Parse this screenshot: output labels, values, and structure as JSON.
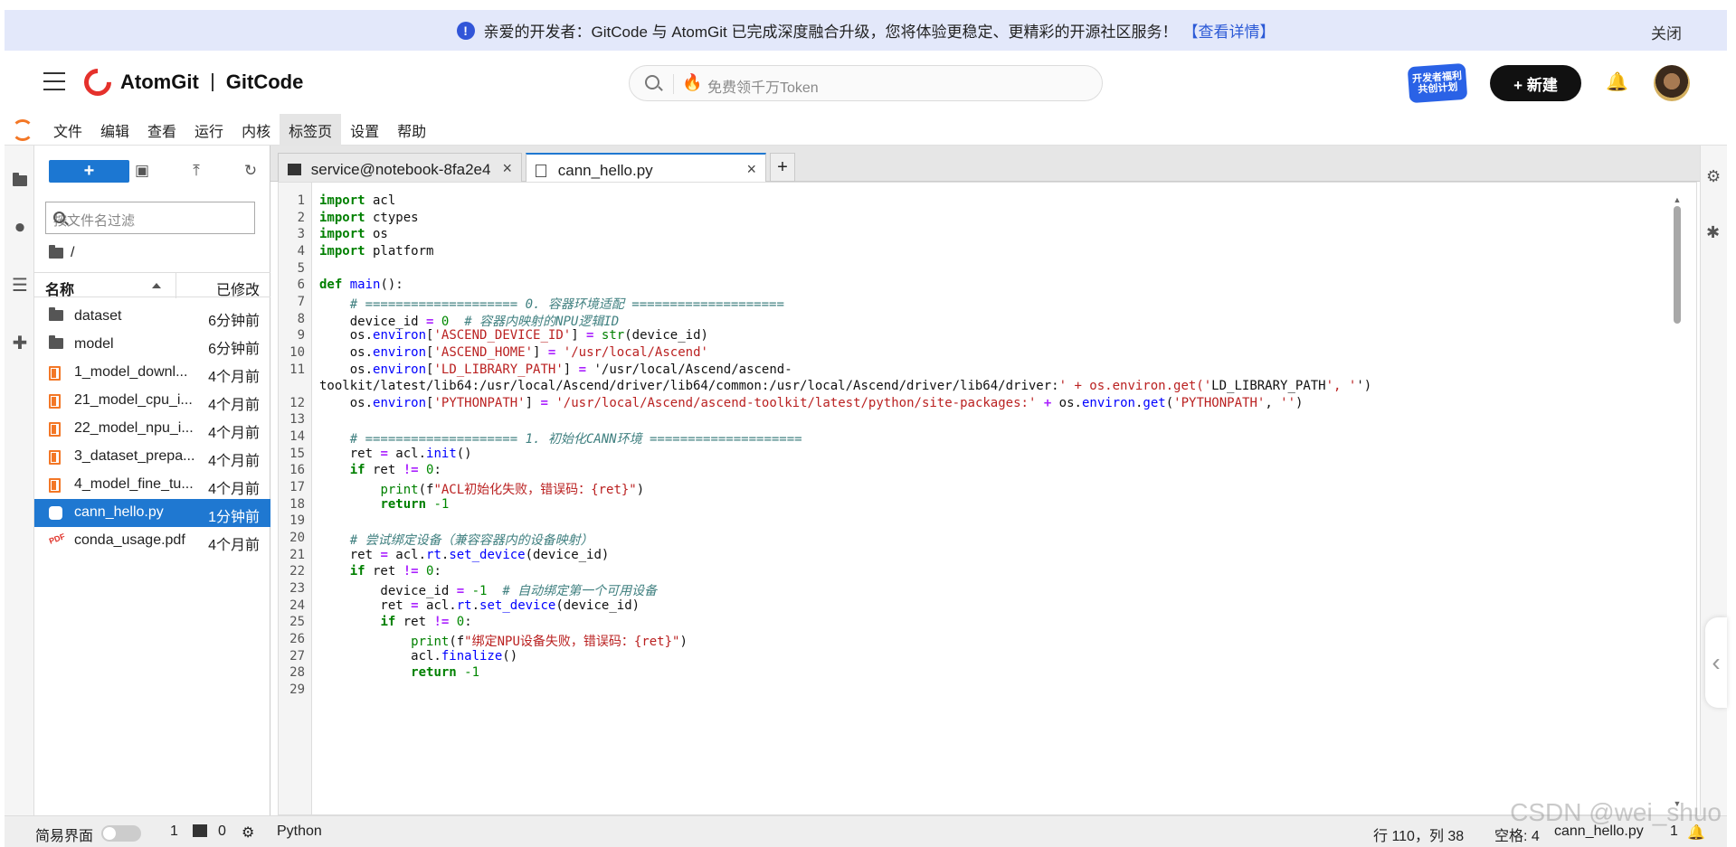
{
  "banner": {
    "info_icon": "!",
    "text": "亲爱的开发者：GitCode 与 AtomGit 已完成深度融合升级，您将体验更稳定、更精彩的开源社区服务！",
    "link": "【查看详情】",
    "close": "关闭"
  },
  "header": {
    "brand_left": "AtomGit",
    "brand_right": "GitCode",
    "search_placeholder": "免费领千万Token",
    "promo_badge": "开发者福利 共创计划",
    "new_button": "+ 新建"
  },
  "menubar": {
    "items": [
      "文件",
      "编辑",
      "查看",
      "运行",
      "内核",
      "标签页",
      "设置",
      "帮助"
    ],
    "active": "标签页"
  },
  "filebrowser": {
    "new_button": "+",
    "filter_placeholder": "按文件名过滤",
    "breadcrumb": "/",
    "col_name": "名称",
    "col_modified": "已修改",
    "files": [
      {
        "name": "dataset",
        "type": "folder",
        "modified": "6分钟前"
      },
      {
        "name": "model",
        "type": "folder",
        "modified": "6分钟前"
      },
      {
        "name": "1_model_downl...",
        "type": "notebook",
        "modified": "4个月前"
      },
      {
        "name": "21_model_cpu_i...",
        "type": "notebook",
        "modified": "4个月前"
      },
      {
        "name": "22_model_npu_i...",
        "type": "notebook",
        "modified": "4个月前"
      },
      {
        "name": "3_dataset_prepa...",
        "type": "notebook",
        "modified": "4个月前"
      },
      {
        "name": "4_model_fine_tu...",
        "type": "notebook",
        "modified": "4个月前"
      },
      {
        "name": "cann_hello.py",
        "type": "python",
        "modified": "1分钟前",
        "selected": true
      },
      {
        "name": "conda_usage.pdf",
        "type": "pdf",
        "modified": "4个月前"
      }
    ]
  },
  "tabs": {
    "terminal": "service@notebook-8fa2e4",
    "file": "cann_hello.py",
    "add": "+"
  },
  "editor": {
    "lines": [
      "import acl",
      "import ctypes",
      "import os",
      "import platform",
      "",
      "def main():",
      "    # ==================== 0. 容器环境适配 ====================",
      "    device_id = 0  # 容器内映射的NPU逻辑ID",
      "    os.environ['ASCEND_DEVICE_ID'] = str(device_id)",
      "    os.environ['ASCEND_HOME'] = '/usr/local/Ascend'",
      "    os.environ['LD_LIBRARY_PATH'] = '/usr/local/Ascend/ascend-",
      "toolkit/latest/lib64:/usr/local/Ascend/driver/lib64/common:/usr/local/Ascend/driver/lib64/driver:' + os.environ.get('LD_LIBRARY_PATH', '')",
      "    os.environ['PYTHONPATH'] = '/usr/local/Ascend/ascend-toolkit/latest/python/site-packages:' + os.environ.get('PYTHONPATH', '')",
      "",
      "    # ==================== 1. 初始化CANN环境 ====================",
      "    ret = acl.init()",
      "    if ret != 0:",
      "        print(f\"ACL初始化失败，错误码：{ret}\")",
      "        return -1",
      "",
      "    # 尝试绑定设备（兼容容器内的设备映射）",
      "    ret = acl.rt.set_device(device_id)",
      "    if ret != 0:",
      "        device_id = -1  # 自动绑定第一个可用设备",
      "        ret = acl.rt.set_device(device_id)",
      "        if ret != 0:",
      "            print(f\"绑定NPU设备失败，错误码：{ret}\")",
      "            acl.finalize()",
      "            return -1",
      ""
    ],
    "line_numbers": [
      "1",
      "2",
      "3",
      "4",
      "5",
      "6",
      "7",
      "8",
      "9",
      "10",
      "11",
      "",
      "12",
      "13",
      "14",
      "15",
      "16",
      "17",
      "18",
      "19",
      "20",
      "21",
      "22",
      "23",
      "24",
      "25",
      "26",
      "27",
      "28",
      "29"
    ]
  },
  "status": {
    "simple_mode": "简易界面",
    "count1": "1",
    "count2": "0",
    "kernel": "Python",
    "position": "行 110，列 38",
    "spaces": "空格: 4",
    "filename": "cann_hello.py",
    "count3": "1"
  },
  "watermark": "CSDN @wei_shuo"
}
